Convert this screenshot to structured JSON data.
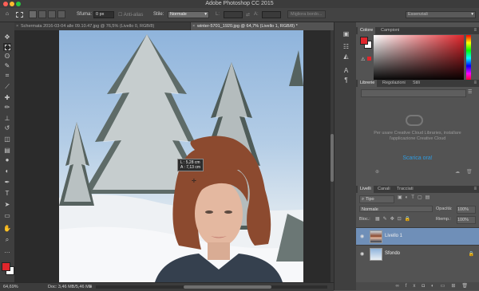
{
  "app": {
    "title": "Adobe Photoshop CC 2015"
  },
  "options": {
    "feather_label": "Sfuma:",
    "feather_value": "0 px",
    "antialias_label": "Anti-alias",
    "style_label": "Stile:",
    "style_value": "Normale",
    "refine_label": "Migliora bordo...",
    "workspace_value": "Essenziali"
  },
  "tabs": [
    {
      "label": "Schermata 2016-03-04 alle 09.10.47.jpg @ 76,5% (Livello 0, RGB/8)"
    },
    {
      "label": "winter-5701_1920.jpg @ 64,7% (Livello 1, RGB/8) *"
    }
  ],
  "tooltip": {
    "line1": "L : 5,28 cm",
    "line2": "A : 7,13 cm"
  },
  "status": {
    "zoom": "64,69%",
    "doc": "Doc: 3,46 MB/5,46 MB"
  },
  "color_panel": {
    "tab_color": "Colore",
    "tab_swatches": "Campioni",
    "fg": "#e0262c",
    "bg": "#ffffff"
  },
  "libraries_panel": {
    "tab_libraries": "Librerie",
    "tab_adjustments": "Regolazioni",
    "tab_styles": "Stili",
    "message": "Per usare Creative Cloud Libraries, installare l'applicazione Creative Cloud",
    "download_link": "Scarica ora!"
  },
  "layers_panel": {
    "tab_layers": "Livelli",
    "tab_channels": "Canali",
    "tab_paths": "Tracciati",
    "filter_kind": "Tipo",
    "blend_mode": "Normale",
    "opacity_label": "Opacità:",
    "opacity_value": "100%",
    "lock_label": "Bloc.:",
    "fill_label": "Riemp.:",
    "fill_value": "100%",
    "layers": [
      {
        "name": "Livello 1",
        "selected": true
      },
      {
        "name": "Sfondo",
        "selected": false
      }
    ]
  }
}
